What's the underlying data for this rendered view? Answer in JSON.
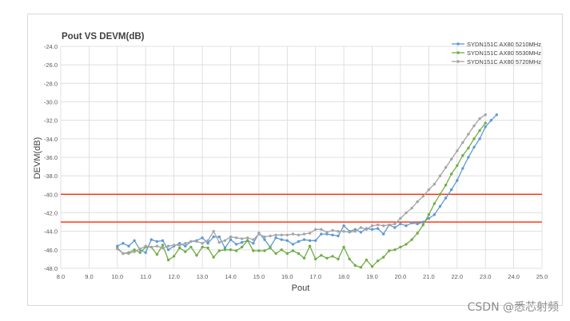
{
  "chart_data": {
    "type": "line",
    "title": "Pout VS DEVM(dB)",
    "xlabel": "Pout",
    "ylabel": "DEVM(dB)",
    "xlim": [
      8.0,
      25.0
    ],
    "ylim": [
      -48.0,
      -24.0
    ],
    "xticks": [
      "8.0",
      "9.0",
      "10.0",
      "11.0",
      "12.0",
      "13.0",
      "14.0",
      "15.0",
      "16.0",
      "17.0",
      "18.0",
      "19.0",
      "20.0",
      "21.0",
      "22.0",
      "23.0",
      "24.0",
      "25.0"
    ],
    "yticks": [
      "-24.0",
      "-26.0",
      "-28.0",
      "-30.0",
      "-32.0",
      "-34.0",
      "-36.0",
      "-38.0",
      "-40.0",
      "-42.0",
      "-44.0",
      "-46.0",
      "-48.0"
    ],
    "grid": true,
    "legend_position": "top-right",
    "reference_lines": [
      {
        "y": -40.0,
        "color": "#ff2a00"
      },
      {
        "y": -43.0,
        "color": "#ff2a00"
      }
    ],
    "series": [
      {
        "name": "SYDN151C AX80 5210MHz",
        "color": "#5b9bd5",
        "x": [
          10.0,
          10.2,
          10.4,
          10.6,
          10.8,
          11.0,
          11.2,
          11.4,
          11.6,
          11.8,
          12.0,
          12.2,
          12.4,
          12.6,
          12.8,
          13.0,
          13.2,
          13.4,
          13.6,
          13.8,
          14.0,
          14.2,
          14.4,
          14.6,
          14.8,
          15.0,
          15.2,
          15.4,
          15.6,
          15.8,
          16.0,
          16.2,
          16.4,
          16.6,
          16.8,
          17.0,
          17.2,
          17.4,
          17.6,
          17.8,
          18.0,
          18.2,
          18.4,
          18.6,
          18.8,
          19.0,
          19.2,
          19.4,
          19.6,
          19.8,
          20.0,
          20.2,
          20.4,
          20.6,
          20.8,
          21.0,
          21.2,
          21.4,
          21.6,
          21.8,
          22.0,
          22.2,
          22.4,
          22.6,
          22.8,
          23.0,
          23.2,
          23.4
        ],
        "values": [
          -45.6,
          -45.3,
          -45.6,
          -45.0,
          -46.0,
          -46.3,
          -44.9,
          -45.1,
          -45.0,
          -46.0,
          -45.6,
          -45.3,
          -45.6,
          -45.1,
          -45.0,
          -44.7,
          -45.3,
          -44.6,
          -44.6,
          -45.8,
          -44.9,
          -45.4,
          -45.2,
          -45.0,
          -45.3,
          -44.2,
          -44.9,
          -45.7,
          -44.7,
          -44.9,
          -45.0,
          -45.4,
          -45.1,
          -44.9,
          -45.0,
          -45.0,
          -44.3,
          -44.3,
          -44.4,
          -44.5,
          -43.4,
          -44.0,
          -43.8,
          -44.1,
          -43.7,
          -43.8,
          -43.7,
          -44.3,
          -43.3,
          -43.6,
          -43.2,
          -43.4,
          -43.1,
          -43.2,
          -43.0,
          -42.6,
          -42.2,
          -41.3,
          -40.4,
          -39.5,
          -38.5,
          -37.2,
          -36.0,
          -34.9,
          -34.0,
          -32.7,
          -32.0,
          -31.4
        ]
      },
      {
        "name": "SYDN151C AX80 5530MHz",
        "color": "#70ad47",
        "x": [
          10.0,
          10.2,
          10.4,
          10.6,
          10.8,
          11.0,
          11.2,
          11.4,
          11.6,
          11.8,
          12.0,
          12.2,
          12.4,
          12.6,
          12.8,
          13.0,
          13.2,
          13.4,
          13.6,
          13.8,
          14.0,
          14.2,
          14.4,
          14.6,
          14.8,
          15.0,
          15.2,
          15.4,
          15.6,
          15.8,
          16.0,
          16.2,
          16.4,
          16.6,
          16.8,
          17.0,
          17.2,
          17.4,
          17.6,
          17.8,
          18.0,
          18.2,
          18.4,
          18.6,
          18.8,
          19.0,
          19.2,
          19.4,
          19.6,
          19.8,
          20.0,
          20.2,
          20.4,
          20.6,
          20.8,
          21.0,
          21.2,
          21.4,
          21.6,
          21.8,
          22.0,
          22.2,
          22.4,
          22.6,
          22.8,
          23.0
        ],
        "values": [
          -45.8,
          -46.4,
          -46.3,
          -46.0,
          -46.3,
          -45.7,
          -45.7,
          -46.5,
          -45.5,
          -47.1,
          -46.7,
          -45.8,
          -46.2,
          -45.7,
          -46.6,
          -45.7,
          -45.8,
          -46.8,
          -46.1,
          -46.0,
          -46.0,
          -46.1,
          -45.7,
          -45.0,
          -46.1,
          -46.1,
          -46.1,
          -45.8,
          -46.4,
          -46.0,
          -46.4,
          -46.1,
          -46.4,
          -46.9,
          -45.6,
          -47.0,
          -46.6,
          -46.9,
          -46.7,
          -47.0,
          -45.7,
          -47.0,
          -47.7,
          -47.9,
          -47.1,
          -47.8,
          -47.2,
          -46.8,
          -46.1,
          -46.0,
          -45.7,
          -45.4,
          -44.9,
          -44.2,
          -43.3,
          -42.2,
          -41.0,
          -40.0,
          -39.0,
          -37.8,
          -36.9,
          -35.8,
          -35.0,
          -34.0,
          -33.1,
          -32.3
        ]
      },
      {
        "name": "SYDN151C AX80 5720MHz",
        "color": "#a5a5a5",
        "x": [
          10.0,
          10.2,
          10.4,
          10.6,
          10.8,
          11.0,
          11.2,
          11.4,
          11.6,
          11.8,
          12.0,
          12.2,
          12.4,
          12.6,
          12.8,
          13.0,
          13.2,
          13.4,
          13.6,
          13.8,
          14.0,
          14.2,
          14.4,
          14.6,
          14.8,
          15.0,
          15.2,
          15.4,
          15.6,
          15.8,
          16.0,
          16.2,
          16.4,
          16.6,
          16.8,
          17.0,
          17.2,
          17.4,
          17.6,
          17.8,
          18.0,
          18.2,
          18.4,
          18.6,
          18.8,
          19.0,
          19.2,
          19.4,
          19.6,
          19.8,
          20.0,
          20.2,
          20.4,
          20.6,
          20.8,
          21.0,
          21.2,
          21.4,
          21.6,
          21.8,
          22.0,
          22.2,
          22.4,
          22.6,
          22.8,
          23.0
        ],
        "values": [
          -45.9,
          -46.4,
          -46.4,
          -46.2,
          -45.9,
          -45.6,
          -45.7,
          -45.6,
          -45.8,
          -45.6,
          -45.5,
          -45.5,
          -45.3,
          -45.1,
          -45.1,
          -45.3,
          -45.0,
          -44.0,
          -45.2,
          -45.0,
          -44.6,
          -44.7,
          -44.8,
          -44.7,
          -44.9,
          -44.3,
          -44.6,
          -44.5,
          -44.4,
          -44.4,
          -44.4,
          -44.3,
          -44.4,
          -44.3,
          -44.2,
          -43.8,
          -43.8,
          -44.1,
          -43.9,
          -44.0,
          -44.0,
          -44.1,
          -44.0,
          -43.6,
          -43.8,
          -43.4,
          -43.3,
          -43.4,
          -43.3,
          -43.2,
          -42.6,
          -42.0,
          -41.5,
          -40.8,
          -40.2,
          -39.5,
          -38.9,
          -38.0,
          -37.1,
          -36.2,
          -35.3,
          -34.4,
          -33.5,
          -32.6,
          -31.8,
          -31.4
        ]
      }
    ]
  },
  "watermark": "CSDN @悉芯射频"
}
